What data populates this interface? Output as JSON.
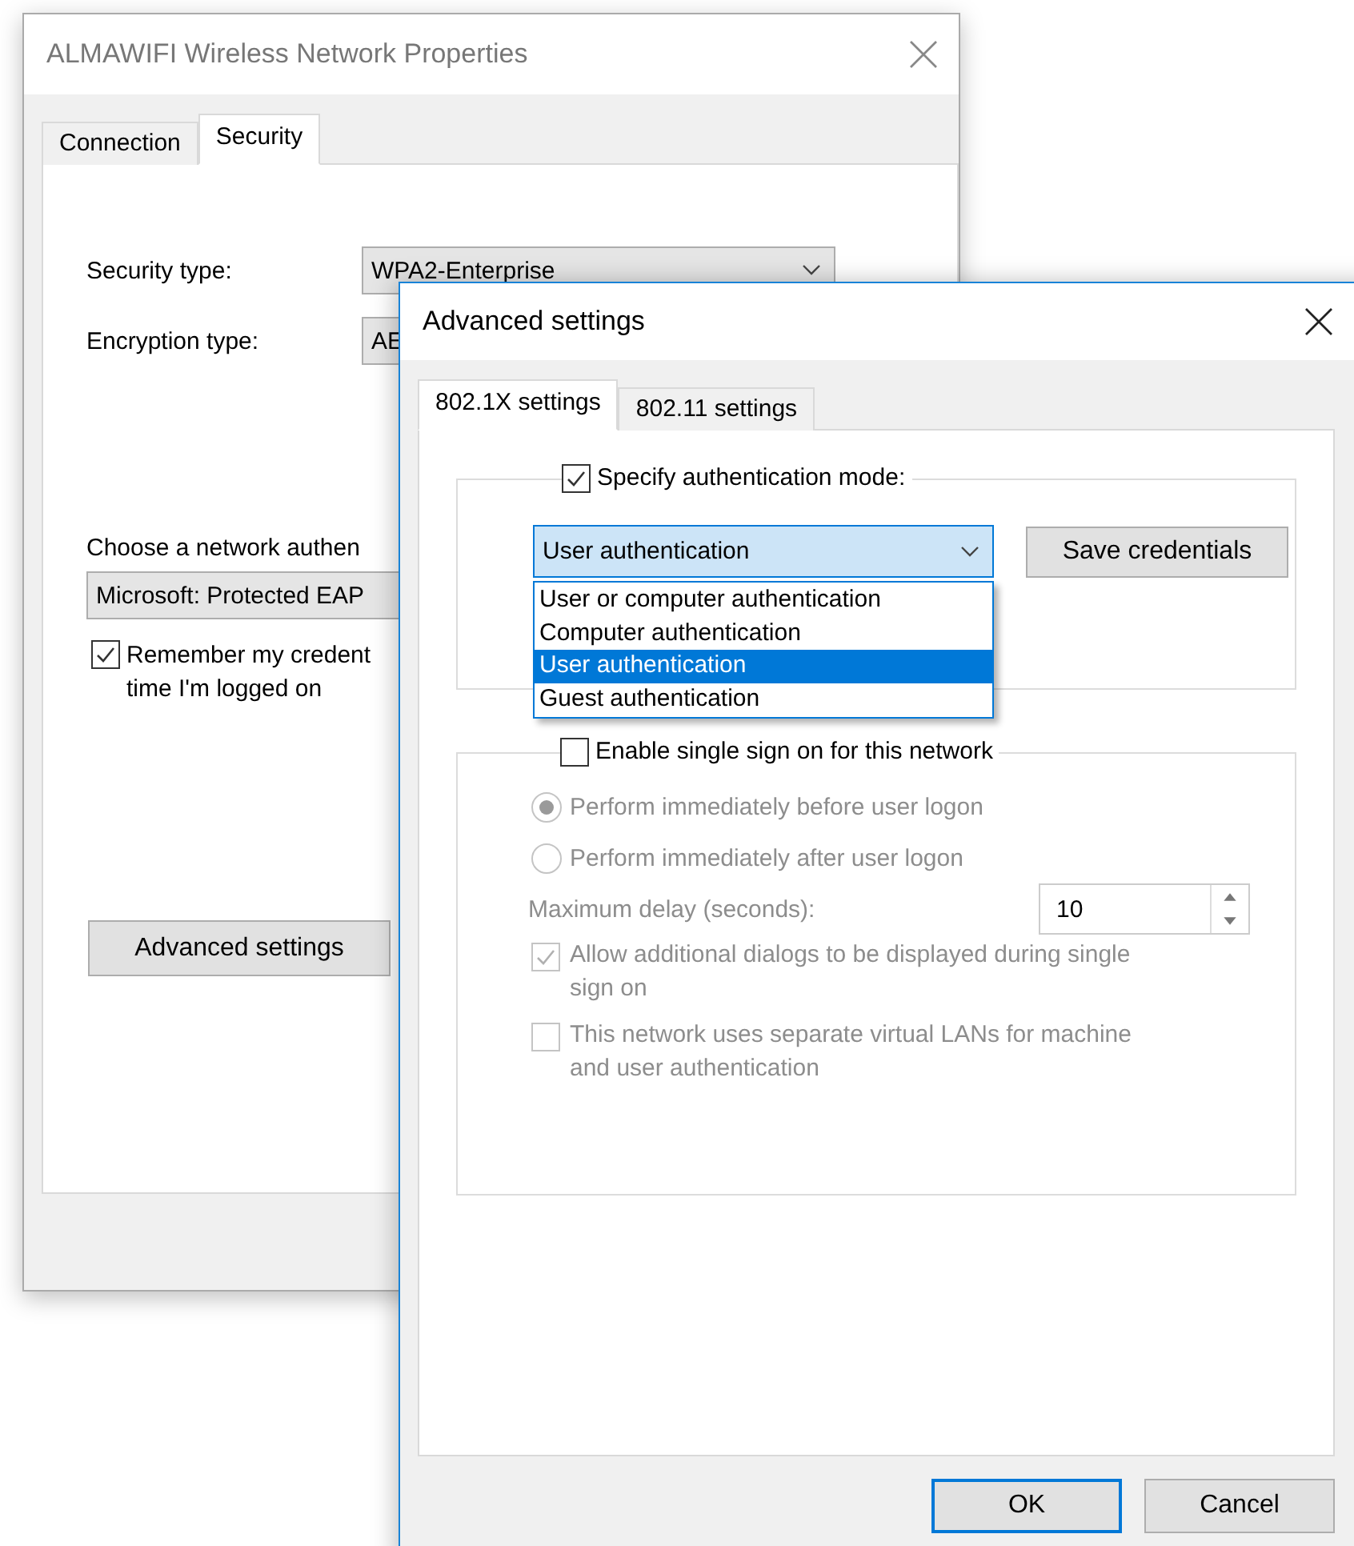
{
  "back_window": {
    "title": "ALMAWIFI Wireless Network Properties",
    "tabs": [
      {
        "label": "Connection",
        "selected": false
      },
      {
        "label": "Security",
        "selected": true
      }
    ],
    "fields": [
      {
        "label": "Security type:",
        "value": "WPA2-Enterprise",
        "chevron": true
      },
      {
        "label": "Encryption type:",
        "value": "AE"
      }
    ],
    "auth_method": {
      "label": "Choose a network authen",
      "value": "Microsoft: Protected EAP"
    },
    "remember": {
      "lines": [
        "Remember my credent",
        "time I'm logged on"
      ],
      "checked": true
    },
    "advanced_button": "Advanced settings"
  },
  "front_window": {
    "title": "Advanced settings",
    "tabs": [
      {
        "label": "802.1X settings",
        "selected": true
      },
      {
        "label": "802.11 settings",
        "selected": false
      }
    ],
    "auth_mode": {
      "label": "Specify authentication mode:",
      "checked": true,
      "value": "User authentication",
      "expanded": true,
      "options": [
        {
          "label": "User or computer authentication",
          "selected": false
        },
        {
          "label": "Computer authentication",
          "selected": false
        },
        {
          "label": "User authentication",
          "selected": true
        },
        {
          "label": "Guest authentication",
          "selected": false
        }
      ]
    },
    "save_credentials_button": "Save credentials",
    "sso": {
      "label": "Enable single sign on for this network",
      "checked": false,
      "radios": [
        {
          "label": "Perform immediately before user logon",
          "selected": true
        },
        {
          "label": "Perform immediately after user logon",
          "selected": false
        }
      ],
      "delay": {
        "label": "Maximum delay (seconds):",
        "value": "10"
      },
      "checkboxes": [
        {
          "lines": [
            "Allow additional dialogs to be displayed during single",
            "sign on"
          ],
          "checked": true
        },
        {
          "lines": [
            "This network uses separate virtual LANs for machine",
            "and user authentication"
          ],
          "checked": false
        }
      ]
    },
    "buttons": [
      {
        "label": "OK",
        "default": true
      },
      {
        "label": "Cancel",
        "default": false
      }
    ]
  }
}
